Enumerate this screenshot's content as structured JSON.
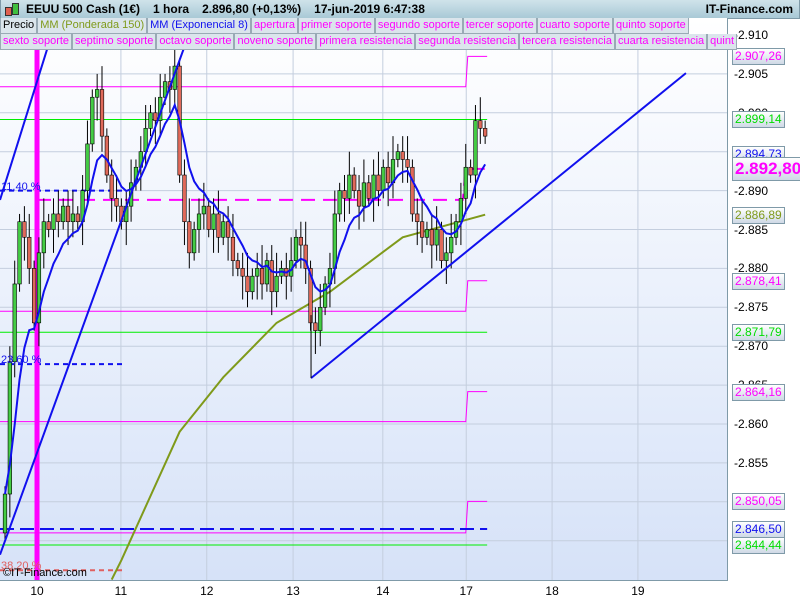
{
  "header": {
    "instrument": "EEUU 500 Cash (1€)",
    "timeframe": "1 hora",
    "price_change": "2.896,80 (+0,13%)",
    "datetime": "17-jun-2019 6:47:38",
    "brand": "IT-Finance.com"
  },
  "legend_row1": [
    {
      "label": "Precio",
      "color": "#000000"
    },
    {
      "label": "MM (Ponderada 150)",
      "color": "#7f9a1a"
    },
    {
      "label": "MM (Exponencial 8)",
      "color": "#1010ee"
    },
    {
      "label": "apertura",
      "color": "#ff00ff"
    },
    {
      "label": "primer soporte",
      "color": "#ff00ff"
    },
    {
      "label": "segundo soporte",
      "color": "#ff00ff"
    },
    {
      "label": "tercer soporte",
      "color": "#ff00ff"
    },
    {
      "label": "cuarto soporte",
      "color": "#ff00ff"
    },
    {
      "label": "quinto soporte",
      "color": "#ff00ff"
    }
  ],
  "legend_row2": [
    {
      "label": "sexto soporte",
      "color": "#ff00ff"
    },
    {
      "label": "septimo soporte",
      "color": "#ff00ff"
    },
    {
      "label": "octavo soporte",
      "color": "#ff00ff"
    },
    {
      "label": "noveno soporte",
      "color": "#ff00ff"
    },
    {
      "label": "primera resistencia",
      "color": "#ff00ff"
    },
    {
      "label": "segunda resistencia",
      "color": "#ff00ff"
    },
    {
      "label": "tercera resistencia",
      "color": "#ff00ff"
    },
    {
      "label": "cuarta resistencia",
      "color": "#ff00ff"
    },
    {
      "label": "quint",
      "color": "#ff00ff"
    }
  ],
  "copyright": "©IT-Finance.com",
  "chart_data": {
    "type": "candlestick",
    "title": "EEUU 500 Cash (1€) 1 hora",
    "ylim": [
      2838,
      2912
    ],
    "yticks": [
      2910,
      2905,
      2900,
      2895,
      2890,
      2885,
      2880,
      2875,
      2870,
      2865,
      2860,
      2855,
      2850,
      2845
    ],
    "ytick_labels": [
      "2.910",
      "2.905",
      "2.900",
      "2.895",
      "2.890",
      "2.885",
      "2.880",
      "2.875",
      "2.870",
      "2.865",
      "2.860",
      "2.855",
      "2.850",
      "2.845"
    ],
    "xticks": [
      {
        "label": "10",
        "index": 6.6
      },
      {
        "label": "11",
        "index": 23.9
      },
      {
        "label": "12",
        "index": 41.6
      },
      {
        "label": "13",
        "index": 59.4
      },
      {
        "label": "14",
        "index": 77.9
      },
      {
        "label": "17",
        "index": 95.1
      },
      {
        "label": "18",
        "index": 112.8
      },
      {
        "label": "19",
        "index": 130.5
      }
    ],
    "first_open": 2846,
    "closes": [
      2851,
      2868,
      2878,
      2886,
      2884,
      2880,
      2873,
      2882,
      2886,
      2885,
      2887,
      2886,
      2888,
      2886,
      2887,
      2886,
      2890,
      2896,
      2902,
      2903,
      2897,
      2892,
      2889,
      2888,
      2886,
      2888,
      2891,
      2893,
      2895,
      2898,
      2900,
      2899,
      2902,
      2904,
      2903,
      2906,
      2892,
      2886,
      2882,
      2885,
      2887,
      2888,
      2885,
      2887,
      2884,
      2886,
      2884,
      2881,
      2880,
      2879,
      2877,
      2879,
      2880,
      2878,
      2881,
      2877,
      2879,
      2880,
      2879,
      2881,
      2884,
      2883,
      2880,
      2873,
      2872,
      2875,
      2878,
      2880,
      2887,
      2890,
      2889,
      2892,
      2890,
      2888,
      2891,
      2889,
      2892,
      2890,
      2893,
      2891,
      2894,
      2895,
      2894,
      2893,
      2887,
      2886,
      2884,
      2885,
      2883,
      2885,
      2881,
      2882,
      2884,
      2886,
      2889,
      2893,
      2892,
      2899,
      2898,
      2897
    ],
    "ema8_period": 8,
    "wma150": [
      [
        22,
        2840
      ],
      [
        24,
        2842.5
      ],
      [
        36,
        2859
      ],
      [
        45,
        2866
      ],
      [
        56,
        2873
      ],
      [
        67,
        2877
      ],
      [
        82,
        2884
      ],
      [
        99,
        2886.9
      ]
    ],
    "levels": [
      {
        "name": "resistance-step-1",
        "color": "#ff00ff",
        "before": 2903.35,
        "after": 2907.26,
        "label": "2.907,26"
      },
      {
        "name": "support-step-1",
        "color": "#ff00ff",
        "before": 2874.5,
        "after": 2878.41,
        "label": "2.878,41"
      },
      {
        "name": "support-step-2",
        "color": "#ff00ff",
        "before": 2860.3,
        "after": 2864.16,
        "label": "2.864,16"
      },
      {
        "name": "support-step-3",
        "color": "#ff00ff",
        "before": 2846.0,
        "after": 2850.05,
        "label": "2.850,05"
      }
    ],
    "green_levels": [
      {
        "value": 2899.14,
        "label": "2.899,14"
      },
      {
        "value": 2871.79,
        "label": "2.871,79"
      },
      {
        "value": 2844.44,
        "label": "2.844,44"
      }
    ],
    "blue_dashed": {
      "value": 2846.5,
      "label": "2.846,50"
    },
    "apertura": {
      "before": 2888.8,
      "after": 2892.8,
      "label": "2.892,80"
    },
    "ema_label": "2.894,73",
    "wma_label": "2.886,89",
    "fib_levels": [
      {
        "label": "11,40 %",
        "value": 2890.0,
        "color": "#1010ee"
      },
      {
        "label": "23,60 %",
        "value": 2867.7,
        "color": "#1010ee"
      },
      {
        "label": "38,20 %",
        "value": 2841.2,
        "color": "#e06060"
      }
    ],
    "trendlines": [
      [
        [
          -1.03,
          2843.2
        ],
        [
          40.5,
          2914.5
        ]
      ],
      [
        [
          -1.03,
          2888.8
        ],
        [
          10.7,
          2912.2
        ]
      ],
      [
        [
          63.1,
          2865.9
        ],
        [
          140.4,
          2905.1
        ]
      ]
    ],
    "session_marker_index": 6.6,
    "step_index": 95
  }
}
